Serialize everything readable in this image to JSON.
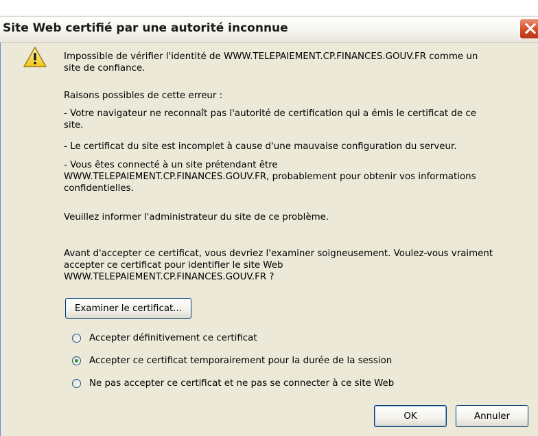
{
  "dialog": {
    "title": "Site Web certifié par une autorité inconnue",
    "message": "Impossible de vérifier l'identité de WWW.TELEPAIEMENT.CP.FINANCES.GOUV.FR comme un\nsite de confiance.",
    "reasons_heading": "Raisons possibles de cette erreur :",
    "reason_1": "- Votre navigateur ne reconnaît pas l'autorité de certification qui a émis le certificat de ce\nsite.",
    "reason_2": "- Le certificat du site est incomplet à cause d'une mauvaise configuration du serveur.",
    "reason_3": "- Vous êtes connecté à un site prétendant être\nWWW.TELEPAIEMENT.CP.FINANCES.GOUV.FR, probablement pour obtenir vos informations\nconfidentielles.",
    "inform_admin": "Veuillez informer l'administrateur du site de ce problème.",
    "question": "Avant d'accepter ce certificat, vous devriez l'examiner soigneusement. Voulez-vous vraiment\naccepter ce certificat pour identifier le site Web\nWWW.TELEPAIEMENT.CP.FINANCES.GOUV.FR ?",
    "examine_button": "Examiner le certificat...",
    "options": [
      {
        "label": "Accepter définitivement ce certificat",
        "selected": false
      },
      {
        "label": "Accepter ce certificat temporairement pour la durée de la session",
        "selected": true
      },
      {
        "label": "Ne pas accepter ce certificat et ne pas se connecter à ce site Web",
        "selected": false
      }
    ],
    "ok_button": "OK",
    "cancel_button": "Annuler"
  },
  "icons": {
    "warning": "warning-icon",
    "close": "close-icon"
  },
  "colors": {
    "dialog_bg": "#ece9d8",
    "close_button": "#d24824",
    "warning_fill": "#f6d84a",
    "radio_dot": "#21a121"
  }
}
